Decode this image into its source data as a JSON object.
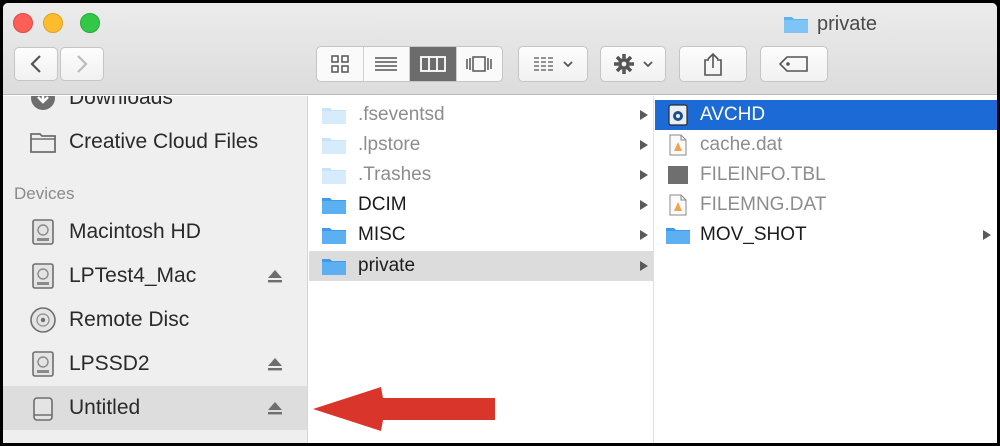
{
  "window": {
    "title": "private"
  },
  "toolbar": {
    "back_icon": "chevron-left-icon",
    "forward_icon": "chevron-right-icon",
    "view_modes": [
      "icon-view",
      "list-view",
      "column-view",
      "cover-flow-view"
    ],
    "active_view": "column-view"
  },
  "sidebar": {
    "partial_item": "Downloads",
    "favorites_item": "Creative Cloud Files",
    "devices_header": "Devices",
    "devices": [
      {
        "label": "Macintosh HD",
        "icon": "hard-drive-icon",
        "eject": false
      },
      {
        "label": "LPTest4_Mac",
        "icon": "hard-drive-icon",
        "eject": true
      },
      {
        "label": "Remote Disc",
        "icon": "disc-icon",
        "eject": false
      },
      {
        "label": "LPSSD2",
        "icon": "hard-drive-icon",
        "eject": true
      },
      {
        "label": "Untitled",
        "icon": "external-drive-icon",
        "eject": true,
        "selected": true
      }
    ]
  },
  "column1": [
    {
      "name": ".fseventsd",
      "type": "folder",
      "hidden": true
    },
    {
      "name": ".lpstore",
      "type": "folder",
      "hidden": true
    },
    {
      "name": ".Trashes",
      "type": "folder",
      "hidden": true
    },
    {
      "name": "DCIM",
      "type": "folder",
      "hidden": false
    },
    {
      "name": "MISC",
      "type": "folder",
      "hidden": false
    },
    {
      "name": "private",
      "type": "folder",
      "hidden": false,
      "selected": true
    }
  ],
  "column2": [
    {
      "name": "AVCHD",
      "type": "package",
      "selected": true
    },
    {
      "name": "cache.dat",
      "type": "file"
    },
    {
      "name": "FILEINFO.TBL",
      "type": "file-dark"
    },
    {
      "name": "FILEMNG.DAT",
      "type": "file"
    },
    {
      "name": "MOV_SHOT",
      "type": "folder"
    }
  ],
  "colors": {
    "selection_blue": "#1b6ad6",
    "annotation_red": "#d9352b"
  }
}
